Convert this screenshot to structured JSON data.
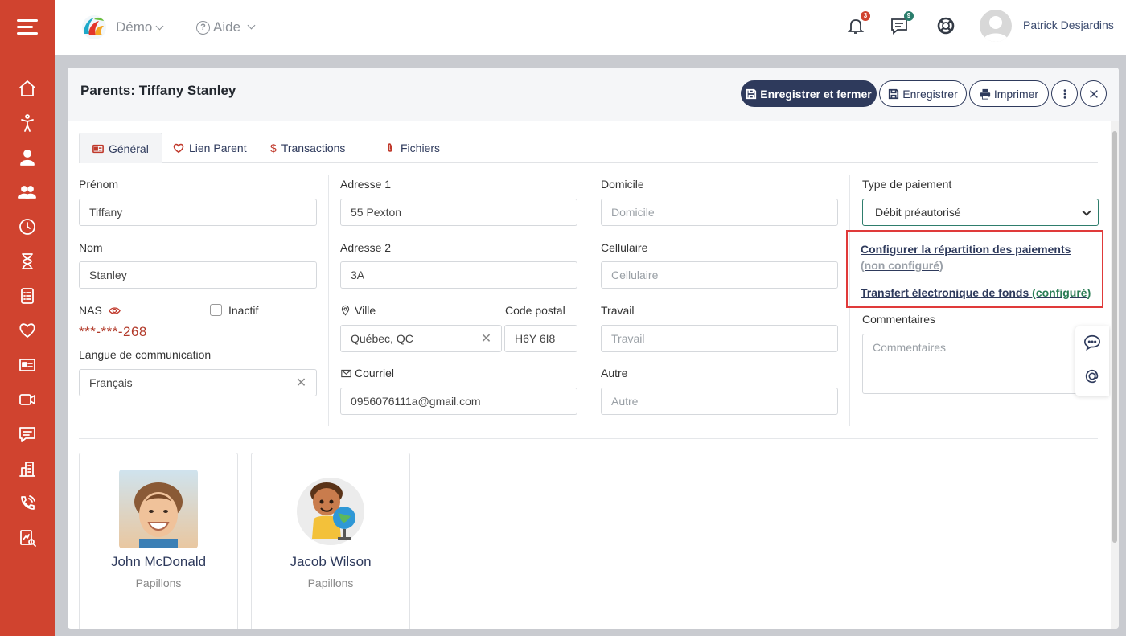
{
  "topbar": {
    "demo_label": "Démo",
    "help_label": "Aide",
    "notifications_count": "3",
    "messages_count": "9",
    "user_name": "Patrick Desjardins"
  },
  "modal": {
    "title": "Parents: Tiffany Stanley",
    "save_close_label": "Enregistrer et fermer",
    "save_label": "Enregistrer",
    "print_label": "Imprimer"
  },
  "tabs": [
    "Général",
    "Lien Parent",
    "Transactions",
    "Fichiers"
  ],
  "form": {
    "prenom_label": "Prénom",
    "prenom_value": "Tiffany",
    "nom_label": "Nom",
    "nom_value": "Stanley",
    "nas_label": "NAS",
    "nas_value": "***-***-268",
    "inactif_label": "Inactif",
    "langue_label": "Langue de communication",
    "langue_value": "Français",
    "adresse1_label": "Adresse 1",
    "adresse1_value": "55 Pexton",
    "adresse2_label": "Adresse 2",
    "adresse2_value": "3A",
    "ville_label": "Ville",
    "ville_value": "Québec, QC",
    "code_postal_label": "Code postal",
    "code_postal_value": "H6Y 6I8",
    "courriel_label": "Courriel",
    "courriel_value": "0956076111a@gmail.com",
    "domicile_label": "Domicile",
    "domicile_placeholder": "Domicile",
    "cellulaire_label": "Cellulaire",
    "cellulaire_placeholder": "Cellulaire",
    "travail_label": "Travail",
    "travail_placeholder": "Travail",
    "autre_label": "Autre",
    "autre_placeholder": "Autre",
    "type_paiement_label": "Type de paiement",
    "type_paiement_value": "Débit préautorisé",
    "repartition_link": "Configurer la répartition des paiements",
    "repartition_status": "(non configuré)",
    "transfert_link": "Transfert électronique de fonds",
    "transfert_status": "(configuré)",
    "commentaires_label": "Commentaires",
    "commentaires_placeholder": "Commentaires"
  },
  "children": [
    {
      "name": "John McDonald",
      "group": "Papillons"
    },
    {
      "name": "Jacob Wilson",
      "group": "Papillons"
    }
  ],
  "colors": {
    "sidebar": "#d0432f",
    "primary": "#2e3a5c",
    "highlight_border": "#e03a3a",
    "configured": "#2a7d55"
  }
}
